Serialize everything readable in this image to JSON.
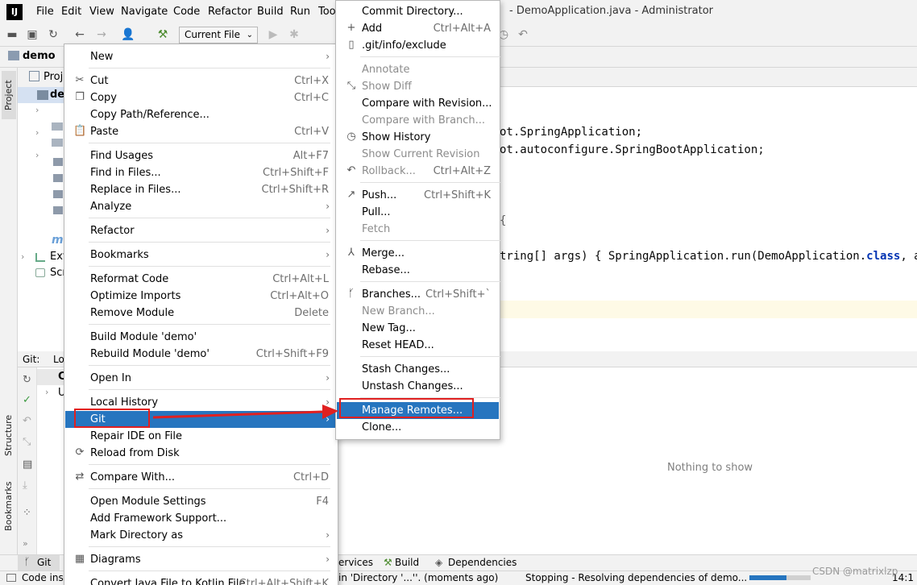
{
  "app": {
    "logo": "IJ",
    "window_title": "- DemoApplication.java - Administrator",
    "menubar": [
      "File",
      "Edit",
      "View",
      "Navigate",
      "Code",
      "Refactor",
      "Build",
      "Run",
      "Too"
    ]
  },
  "toolbar": {
    "run_config": "Current File"
  },
  "navbar": {
    "project": "demo"
  },
  "project_pane": {
    "header": "Proj",
    "root": "de",
    "items": [
      "Ext",
      "Scr"
    ],
    "side_tab": "Project"
  },
  "editor": {
    "code_lines": [
      "ot.SpringApplication;",
      "ot.autoconfigure.SpringBootApplication;",
      "{",
      "tring[] args) { SpringApplication.run(DemoApplication.",
      "class",
      ", args);"
    ]
  },
  "git_pane": {
    "title": "Git:",
    "tab": "Lo",
    "row_header": "C",
    "row_item": "U",
    "empty_text": "Nothing to show"
  },
  "left_tabs": {
    "structure": "Structure",
    "bookmarks": "Bookmarks"
  },
  "bottom_tabs": {
    "git": "Git",
    "services": "ervices",
    "build": "Build",
    "dependencies": "Dependencies"
  },
  "status": {
    "left": "Code ins",
    "message": "in 'Directory '...''. (moments ago)",
    "task": "Stopping - Resolving dependencies of demo...",
    "progress": 0.6,
    "position": "14:1",
    "watermark": "CSDN @matrixlzp"
  },
  "context_menu": {
    "items": [
      {
        "label": "New",
        "arrow": true
      },
      {
        "label": "Cut",
        "shortcut": "Ctrl+X",
        "icon": "scissors-icon"
      },
      {
        "label": "Copy",
        "shortcut": "Ctrl+C",
        "icon": "copy-icon"
      },
      {
        "label": "Copy Path/Reference..."
      },
      {
        "label": "Paste",
        "shortcut": "Ctrl+V",
        "icon": "paste-icon"
      },
      {
        "label": "Find Usages",
        "shortcut": "Alt+F7"
      },
      {
        "label": "Find in Files...",
        "shortcut": "Ctrl+Shift+F"
      },
      {
        "label": "Replace in Files...",
        "shortcut": "Ctrl+Shift+R"
      },
      {
        "label": "Analyze",
        "arrow": true
      },
      {
        "label": "Refactor",
        "arrow": true
      },
      {
        "label": "Bookmarks",
        "arrow": true
      },
      {
        "label": "Reformat Code",
        "shortcut": "Ctrl+Alt+L"
      },
      {
        "label": "Optimize Imports",
        "shortcut": "Ctrl+Alt+O"
      },
      {
        "label": "Remove Module",
        "shortcut": "Delete"
      },
      {
        "label": "Build Module 'demo'"
      },
      {
        "label": "Rebuild Module 'demo'",
        "shortcut": "Ctrl+Shift+F9"
      },
      {
        "label": "Open In",
        "arrow": true
      },
      {
        "label": "Local History",
        "arrow": true
      },
      {
        "label": "Git",
        "arrow": true,
        "selected": true
      },
      {
        "label": "Repair IDE on File"
      },
      {
        "label": "Reload from Disk",
        "icon": "reload-icon"
      },
      {
        "label": "Compare With...",
        "shortcut": "Ctrl+D",
        "icon": "compare-icon"
      },
      {
        "label": "Open Module Settings",
        "shortcut": "F4"
      },
      {
        "label": "Add Framework Support..."
      },
      {
        "label": "Mark Directory as",
        "arrow": true
      },
      {
        "label": "Diagrams",
        "arrow": true,
        "icon": "diagram-icon"
      },
      {
        "label": "Convert Java File to Kotlin File",
        "shortcut": "Ctrl+Alt+Shift+K"
      }
    ]
  },
  "git_menu": {
    "items": [
      {
        "label": "Commit Directory..."
      },
      {
        "label": "Add",
        "shortcut": "Ctrl+Alt+A",
        "icon": "plus-icon"
      },
      {
        "label": ".git/info/exclude",
        "icon": "file-icon"
      },
      {
        "label": "Annotate",
        "disabled": true
      },
      {
        "label": "Show Diff",
        "disabled": true,
        "icon": "diff-icon"
      },
      {
        "label": "Compare with Revision..."
      },
      {
        "label": "Compare with Branch...",
        "disabled": true
      },
      {
        "label": "Show History",
        "icon": "clock-icon"
      },
      {
        "label": "Show Current Revision",
        "disabled": true
      },
      {
        "label": "Rollback...",
        "shortcut": "Ctrl+Alt+Z",
        "disabled": true,
        "icon": "rollback-icon"
      },
      {
        "label": "Push...",
        "shortcut": "Ctrl+Shift+K",
        "icon": "push-icon"
      },
      {
        "label": "Pull..."
      },
      {
        "label": "Fetch",
        "disabled": true
      },
      {
        "label": "Merge...",
        "icon": "merge-icon"
      },
      {
        "label": "Rebase..."
      },
      {
        "label": "Branches...",
        "shortcut": "Ctrl+Shift+`",
        "icon": "branch-icon"
      },
      {
        "label": "New Branch...",
        "disabled": true
      },
      {
        "label": "New Tag..."
      },
      {
        "label": "Reset HEAD..."
      },
      {
        "label": "Stash Changes..."
      },
      {
        "label": "Unstash Changes..."
      },
      {
        "label": "Manage Remotes...",
        "selected": true
      },
      {
        "label": "Clone..."
      }
    ]
  },
  "colors": {
    "selection": "#2675bf",
    "annotation": "#e02020"
  }
}
